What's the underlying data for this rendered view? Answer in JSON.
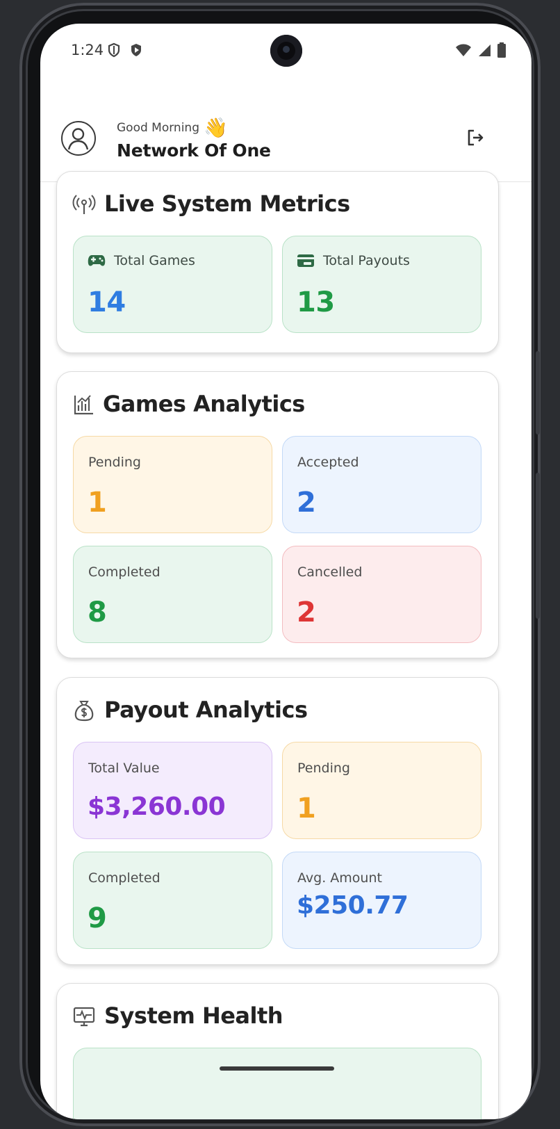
{
  "status_bar": {
    "time": "1:24",
    "left_icons": [
      "vpn-shield-icon",
      "play-protect-icon"
    ],
    "right_icons": [
      "wifi-icon",
      "signal-icon",
      "battery-icon"
    ]
  },
  "header": {
    "greeting": "Good Morning",
    "greeting_emoji": "👋",
    "user_name": "Network Of One",
    "avatar_icon": "user-circle-icon",
    "logout_icon": "logout-icon"
  },
  "live_metrics": {
    "title": "Live System Metrics",
    "icon": "broadcast-icon",
    "tiles": [
      {
        "label": "Total Games",
        "value": "14",
        "icon": "gamepad-icon",
        "value_color": "#2f7de1"
      },
      {
        "label": "Total Payouts",
        "value": "13",
        "icon": "credit-card-icon",
        "value_color": "#1f9a45"
      }
    ]
  },
  "games_analytics": {
    "title": "Games Analytics",
    "icon": "bar-chart-icon",
    "tiles": [
      {
        "label": "Pending",
        "value": "1",
        "value_color": "#f0a020"
      },
      {
        "label": "Accepted",
        "value": "2",
        "value_color": "#2f6fd8"
      },
      {
        "label": "Completed",
        "value": "8",
        "value_color": "#1f9a45"
      },
      {
        "label": "Cancelled",
        "value": "2",
        "value_color": "#de3535"
      }
    ]
  },
  "payout_analytics": {
    "title": "Payout Analytics",
    "icon": "money-bag-icon",
    "tiles": [
      {
        "label": "Total Value",
        "value": "$3,260.00",
        "value_color": "#8a35d4"
      },
      {
        "label": "Pending",
        "value": "1",
        "value_color": "#f0a020"
      },
      {
        "label": "Completed",
        "value": "9",
        "value_color": "#1f9a45"
      },
      {
        "label": "Avg. Amount",
        "value": "$250.77",
        "value_color": "#2f6fd8"
      }
    ]
  },
  "system_health": {
    "title": "System Health",
    "icon": "monitor-pulse-icon"
  }
}
